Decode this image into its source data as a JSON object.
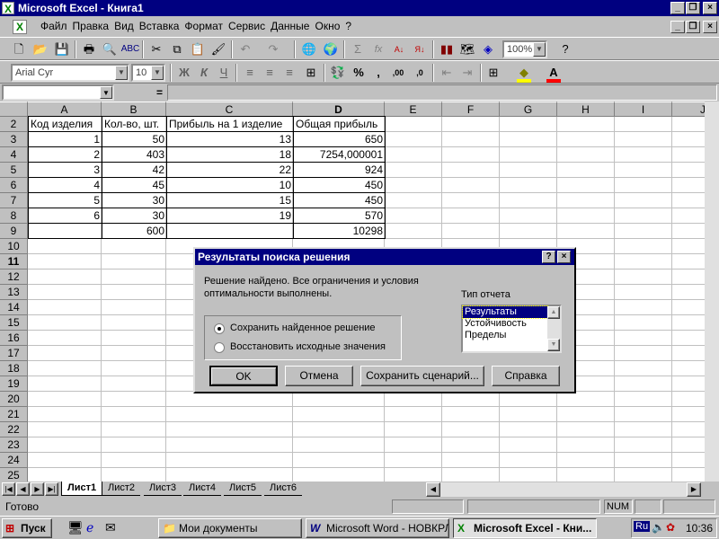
{
  "window": {
    "title": "Microsoft Excel - Книга1"
  },
  "menu": [
    "Файл",
    "Правка",
    "Вид",
    "Вставка",
    "Формат",
    "Сервис",
    "Данные",
    "Окно",
    "?"
  ],
  "toolbar": {
    "zoom": "100%",
    "font": "Arial Cyr",
    "size": "10",
    "bold": "Ж",
    "italic": "К",
    "underline": "Ч",
    "percent": "%",
    "comma": ",",
    "inc_dec": ",00",
    "dec_dec": ",0"
  },
  "formula_bar": {
    "namebox": "",
    "equals": "="
  },
  "columns": [
    "A",
    "B",
    "C",
    "D",
    "E",
    "F",
    "G",
    "H",
    "I",
    "J"
  ],
  "rows": [
    "2",
    "3",
    "4",
    "5",
    "6",
    "7",
    "8",
    "9",
    "10",
    "11",
    "12",
    "13",
    "14",
    "15",
    "16",
    "17",
    "18",
    "19",
    "20",
    "21",
    "22",
    "23",
    "24",
    "25"
  ],
  "table": {
    "headers": [
      "Код изделия",
      "Кол-во, шт.",
      "Прибыль на 1 изделие",
      "Общая прибыль"
    ],
    "data": [
      [
        "1",
        "50",
        "13",
        "650"
      ],
      [
        "2",
        "403",
        "18",
        "7254,000001"
      ],
      [
        "3",
        "42",
        "22",
        "924"
      ],
      [
        "4",
        "45",
        "10",
        "450"
      ],
      [
        "5",
        "30",
        "15",
        "450"
      ],
      [
        "6",
        "30",
        "19",
        "570"
      ],
      [
        "",
        "600",
        "",
        "10298"
      ]
    ]
  },
  "sheets": [
    "Лист1",
    "Лист2",
    "Лист3",
    "Лист4",
    "Лист5",
    "Лист6"
  ],
  "status": {
    "text": "Готово",
    "num": "NUM"
  },
  "taskbar": {
    "start": "Пуск",
    "tasks": [
      "Мои документы",
      "Microsoft Word - НОВКРЛ...",
      "Microsoft Excel - Кни..."
    ],
    "lang": "Ru",
    "time": "10:36"
  },
  "dialog": {
    "title": "Результаты поиска решения",
    "help": "?",
    "message_line1": "Решение найдено. Все ограничения и условия",
    "message_line2": "оптимальности выполнены.",
    "report_label": "Тип отчета",
    "reports": [
      "Результаты",
      "Устойчивость",
      "Пределы"
    ],
    "option_keep": "Сохранить найденное решение",
    "option_restore": "Восстановить исходные значения",
    "btn_ok": "OK",
    "btn_cancel": "Отмена",
    "btn_save": "Сохранить сценарий...",
    "btn_help": "Справка"
  }
}
